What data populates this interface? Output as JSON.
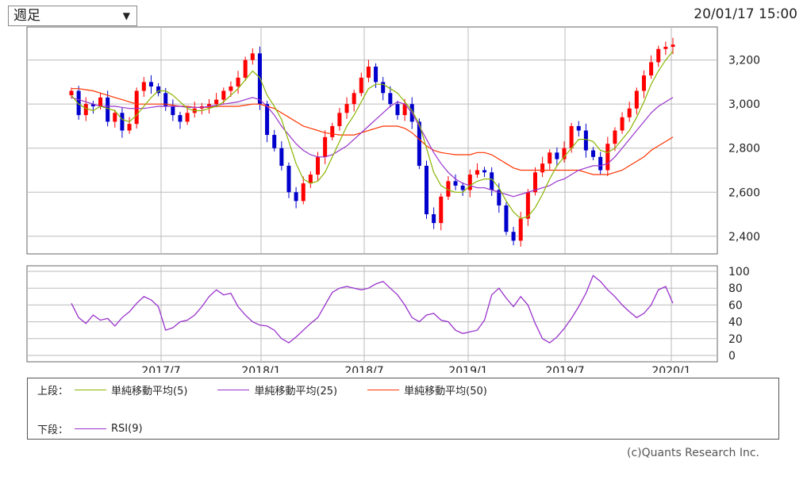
{
  "header": {
    "period": "週足",
    "timestamp": "20/01/17 15:00"
  },
  "colors": {
    "up": "#ff0000",
    "down": "#0000cc",
    "ma5": "#8ab400",
    "ma25": "#9933cc",
    "ma50": "#ff3300",
    "rsi": "#9933cc"
  },
  "legend": {
    "upper_label": "上段：",
    "lower_label": "下段：",
    "ma5": "単純移動平均(5)",
    "ma25": "単純移動平均(25)",
    "ma50": "単純移動平均(50)",
    "rsi": "RSI(9)"
  },
  "copyright": "(c)Quants Research Inc.",
  "chart_data": [
    {
      "type": "candlestick",
      "x_ticks": [
        "2017/7",
        "2018/1",
        "2018/7",
        "2019/1",
        "2019/7",
        "2020/1"
      ],
      "y_ticks": [
        "2,400",
        "2,600",
        "2,800",
        "3,000",
        "3,200"
      ],
      "ylim": [
        2320,
        3350
      ],
      "close": [
        3060,
        2950,
        3000,
        2990,
        3030,
        2920,
        2960,
        2880,
        2910,
        3060,
        3100,
        3080,
        3050,
        2990,
        2950,
        2920,
        2960,
        2980,
        2990,
        3000,
        3020,
        3060,
        3080,
        3120,
        3200,
        3230,
        3000,
        2860,
        2800,
        2720,
        2600,
        2560,
        2640,
        2680,
        2760,
        2850,
        2900,
        2960,
        3000,
        3050,
        3120,
        3170,
        3100,
        3050,
        3000,
        2950,
        3000,
        2920,
        2720,
        2500,
        2460,
        2580,
        2650,
        2630,
        2610,
        2680,
        2700,
        2690,
        2610,
        2540,
        2420,
        2380,
        2480,
        2600,
        2690,
        2730,
        2780,
        2750,
        2800,
        2900,
        2880,
        2790,
        2760,
        2700,
        2820,
        2880,
        2940,
        2980,
        3060,
        3130,
        3190,
        3250,
        3260,
        3270
      ],
      "ma5": [
        3040,
        3000,
        2980,
        2970,
        2990,
        2980,
        2970,
        2930,
        2920,
        2950,
        2990,
        3030,
        3060,
        3060,
        3040,
        3010,
        2980,
        2970,
        2970,
        2980,
        2990,
        3010,
        3040,
        3070,
        3110,
        3150,
        3120,
        3040,
        2990,
        2930,
        2830,
        2730,
        2660,
        2640,
        2650,
        2690,
        2760,
        2830,
        2900,
        2950,
        3010,
        3070,
        3090,
        3090,
        3070,
        3050,
        3010,
        2970,
        2910,
        2800,
        2690,
        2630,
        2610,
        2600,
        2600,
        2630,
        2650,
        2660,
        2660,
        2620,
        2560,
        2510,
        2480,
        2490,
        2530,
        2590,
        2660,
        2720,
        2760,
        2800,
        2840,
        2840,
        2830,
        2790,
        2780,
        2800,
        2840,
        2880,
        2940,
        3010,
        3090,
        3150,
        3200,
        3240
      ],
      "ma25": [
        3030,
        3020,
        3010,
        3000,
        2990,
        2990,
        2990,
        2985,
        2980,
        2980,
        2980,
        2985,
        2990,
        2990,
        2990,
        2990,
        2985,
        2985,
        2985,
        2990,
        2995,
        3000,
        3005,
        3010,
        3020,
        3030,
        3020,
        2990,
        2950,
        2900,
        2860,
        2820,
        2790,
        2770,
        2760,
        2760,
        2770,
        2790,
        2810,
        2840,
        2870,
        2900,
        2930,
        2960,
        2990,
        3010,
        3000,
        2960,
        2900,
        2840,
        2780,
        2730,
        2690,
        2660,
        2640,
        2630,
        2620,
        2620,
        2610,
        2600,
        2590,
        2580,
        2590,
        2600,
        2610,
        2620,
        2630,
        2650,
        2660,
        2680,
        2700,
        2710,
        2720,
        2720,
        2730,
        2760,
        2800,
        2840,
        2880,
        2920,
        2960,
        2990,
        3010,
        3030
      ],
      "ma50": [
        3070,
        3070,
        3065,
        3060,
        3050,
        3040,
        3030,
        3020,
        3010,
        3000,
        3000,
        3000,
        3000,
        3000,
        2995,
        2990,
        2990,
        2985,
        2985,
        2985,
        2990,
        2990,
        2990,
        2990,
        2995,
        3000,
        3000,
        2990,
        2980,
        2960,
        2940,
        2920,
        2900,
        2890,
        2880,
        2870,
        2865,
        2860,
        2860,
        2860,
        2870,
        2880,
        2890,
        2900,
        2900,
        2900,
        2890,
        2870,
        2840,
        2810,
        2790,
        2780,
        2775,
        2770,
        2770,
        2770,
        2780,
        2780,
        2770,
        2750,
        2730,
        2710,
        2700,
        2700,
        2700,
        2700,
        2700,
        2700,
        2700,
        2700,
        2700,
        2690,
        2680,
        2680,
        2680,
        2690,
        2700,
        2720,
        2740,
        2760,
        2790,
        2810,
        2830,
        2850
      ]
    },
    {
      "type": "line",
      "series_name": "RSI(9)",
      "y_ticks": [
        "0",
        "20",
        "40",
        "60",
        "80",
        "100"
      ],
      "ylim": [
        0,
        100
      ],
      "values": [
        62,
        45,
        38,
        48,
        42,
        44,
        35,
        45,
        52,
        62,
        70,
        66,
        58,
        30,
        33,
        40,
        42,
        48,
        58,
        70,
        78,
        72,
        74,
        58,
        48,
        40,
        36,
        35,
        30,
        20,
        15,
        22,
        30,
        38,
        45,
        60,
        75,
        80,
        82,
        80,
        78,
        80,
        85,
        88,
        80,
        72,
        60,
        45,
        40,
        48,
        50,
        42,
        40,
        30,
        26,
        28,
        30,
        42,
        72,
        80,
        68,
        58,
        70,
        60,
        38,
        20,
        15,
        22,
        32,
        44,
        58,
        74,
        95,
        88,
        78,
        70,
        60,
        52,
        45,
        50,
        60,
        78,
        82,
        62
      ]
    }
  ]
}
